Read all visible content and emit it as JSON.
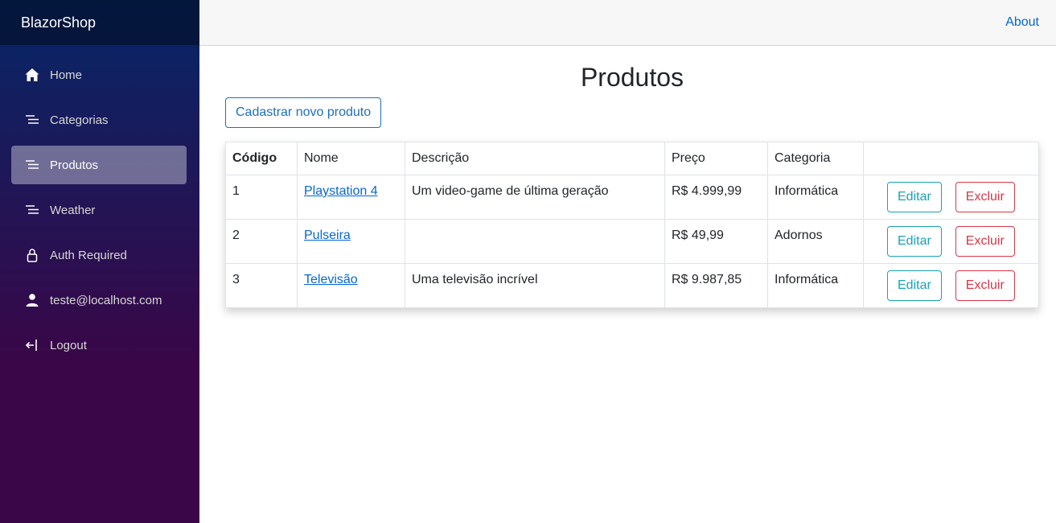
{
  "brand": "BlazorShop",
  "topbar": {
    "about": "About"
  },
  "sidebar": {
    "items": [
      {
        "label": "Home",
        "icon": "home-icon"
      },
      {
        "label": "Categorias",
        "icon": "list-icon"
      },
      {
        "label": "Produtos",
        "icon": "list-icon",
        "active": true
      },
      {
        "label": "Weather",
        "icon": "list-icon"
      },
      {
        "label": "Auth Required",
        "icon": "lock-icon"
      },
      {
        "label": "teste@localhost.com",
        "icon": "person-icon"
      },
      {
        "label": "Logout",
        "icon": "logout-icon"
      }
    ]
  },
  "main": {
    "title": "Produtos",
    "new_button": "Cadastrar novo produto",
    "table": {
      "headers": [
        "Código",
        "Nome",
        "Descrição",
        "Preço",
        "Categoria",
        ""
      ],
      "rows": [
        {
          "codigo": "1",
          "nome": "Playstation 4",
          "descricao": "Um video-game de última geração",
          "preco": "R$ 4.999,99",
          "categoria": "Informática"
        },
        {
          "codigo": "2",
          "nome": "Pulseira",
          "descricao": "",
          "preco": "R$ 49,99",
          "categoria": "Adornos"
        },
        {
          "codigo": "3",
          "nome": "Televisão",
          "descricao": "Uma televisão incrível",
          "preco": "R$ 9.987,85",
          "categoria": "Informática"
        }
      ],
      "edit_label": "Editar",
      "delete_label": "Excluir"
    }
  },
  "colors": {
    "primary": "#1b6ec2",
    "info": "#17a2b8",
    "danger": "#dc3545",
    "link": "#0366d6",
    "sidebar_top": "#052767",
    "sidebar_bottom": "#3a0647"
  }
}
